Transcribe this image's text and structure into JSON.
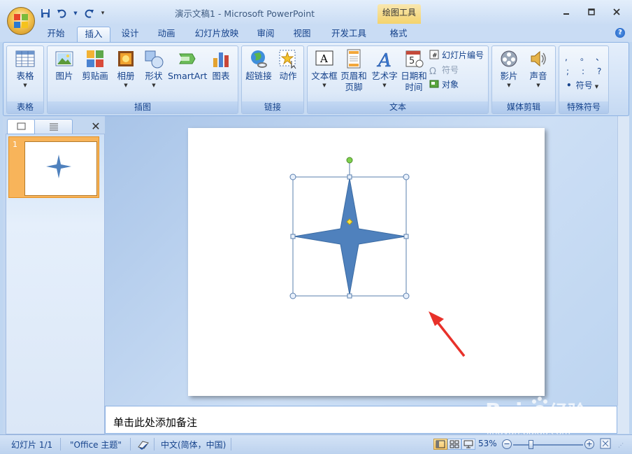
{
  "window": {
    "title": "演示文稿1 - Microsoft PowerPoint",
    "contextual_header": "绘图工具",
    "controls": [
      "minimize-icon",
      "maximize-icon",
      "close-icon"
    ]
  },
  "quick_access": [
    "save-icon",
    "undo-icon",
    "redo-icon",
    "customize-qat-icon"
  ],
  "tabs": [
    "开始",
    "插入",
    "设计",
    "动画",
    "幻灯片放映",
    "审阅",
    "视图",
    "开发工具",
    "格式"
  ],
  "active_tab": "插入",
  "ribbon": {
    "table_group": {
      "label": "表格",
      "button": "表格"
    },
    "illustrations_group": {
      "label": "插图",
      "buttons": [
        "图片",
        "剪贴画",
        "相册",
        "形状",
        "SmartArt",
        "图表"
      ]
    },
    "links_group": {
      "label": "链接",
      "buttons": [
        "超链接",
        "动作"
      ]
    },
    "text_group": {
      "label": "文本",
      "buttons": [
        "文本框",
        "页眉和",
        "页脚",
        "艺术字",
        "日期和",
        "时间"
      ],
      "small_buttons": [
        "幻灯片编号",
        "符号",
        "对象"
      ]
    },
    "media_group": {
      "label": "媒体剪辑",
      "buttons": [
        "影片",
        "声音"
      ]
    },
    "special_symbols_group": {
      "label": "特殊符号",
      "symbols": [
        ",",
        "。",
        "、",
        ";",
        ":",
        "?"
      ],
      "button": "符号"
    }
  },
  "side_pane": {
    "slide_number": "1"
  },
  "notes": {
    "placeholder": "单击此处添加备注"
  },
  "status_bar": {
    "slide_info": "幻灯片 1/1",
    "theme": "\"Office 主题\"",
    "language": "中文(简体，中国)",
    "zoom": "53%"
  },
  "colors": {
    "shape_fill": "#4f81bd",
    "shape_stroke": "#3a6aa2",
    "arrow": "#e8312a",
    "accent": "#15428b"
  },
  "watermark": {
    "brand": "Bai",
    "brand2": "经验",
    "url": "jingyan.baidu.com"
  }
}
